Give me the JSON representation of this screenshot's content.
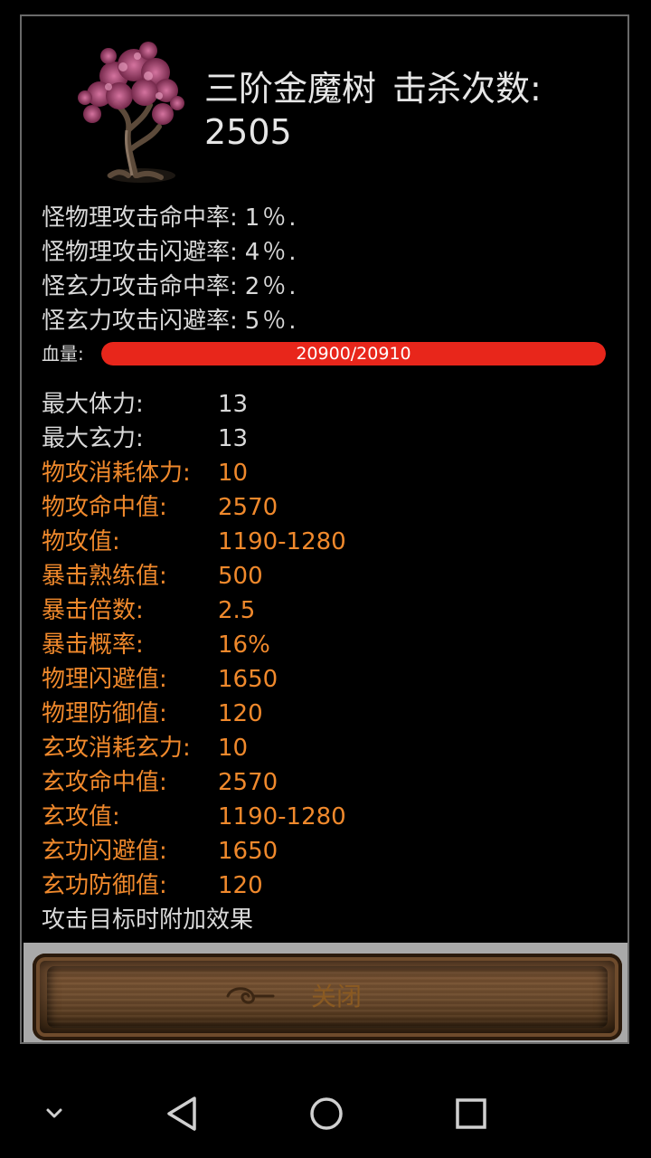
{
  "monster": {
    "name": "三阶金魔树",
    "kills_label": "击杀次数:",
    "kills_value": "2505"
  },
  "rates": [
    {
      "label": "怪物理攻击命中率:",
      "value": "1％."
    },
    {
      "label": "怪物理攻击闪避率:",
      "value": "4％."
    },
    {
      "label": "怪玄力攻击命中率:",
      "value": "2％."
    },
    {
      "label": "怪玄力攻击闪避率:",
      "value": "5％."
    }
  ],
  "hp": {
    "label": "血量:",
    "text": "20900/20910",
    "current": 20900,
    "max": 20910
  },
  "stats": [
    {
      "label": "最大体力:",
      "value": "13",
      "color": "normal"
    },
    {
      "label": "最大玄力:",
      "value": "13",
      "color": "normal"
    },
    {
      "label": "物攻消耗体力:",
      "value": "10",
      "color": "orange"
    },
    {
      "label": "物攻命中值:",
      "value": "2570",
      "color": "orange"
    },
    {
      "label": "物攻值:",
      "value": "1190-1280",
      "color": "orange"
    },
    {
      "label": "暴击熟练值:",
      "value": "500",
      "color": "orange"
    },
    {
      "label": "暴击倍数:",
      "value": "2.5",
      "color": "orange"
    },
    {
      "label": "暴击概率:",
      "value": "16%",
      "color": "orange"
    },
    {
      "label": "物理闪避值:",
      "value": "1650",
      "color": "orange"
    },
    {
      "label": "物理防御值:",
      "value": "120",
      "color": "orange"
    },
    {
      "label": "玄攻消耗玄力:",
      "value": "10",
      "color": "orange"
    },
    {
      "label": "玄攻命中值:",
      "value": "2570",
      "color": "orange"
    },
    {
      "label": "玄攻值:",
      "value": "1190-1280",
      "color": "orange"
    },
    {
      "label": "玄功闪避值:",
      "value": "1650",
      "color": "orange"
    },
    {
      "label": "玄功防御值:",
      "value": "120",
      "color": "orange"
    }
  ],
  "extra_title": "攻击目标时附加效果",
  "extra_partial": "",
  "close_button": "关闭",
  "colors": {
    "normal_text": "#d9d9d9",
    "orange_text": "#f0892c",
    "hp_bar": "#e8261b",
    "panel_border": "#6a6a6a"
  },
  "navbar": {
    "icons": [
      "chevron-down-icon",
      "back-icon",
      "home-icon",
      "recents-icon"
    ]
  }
}
